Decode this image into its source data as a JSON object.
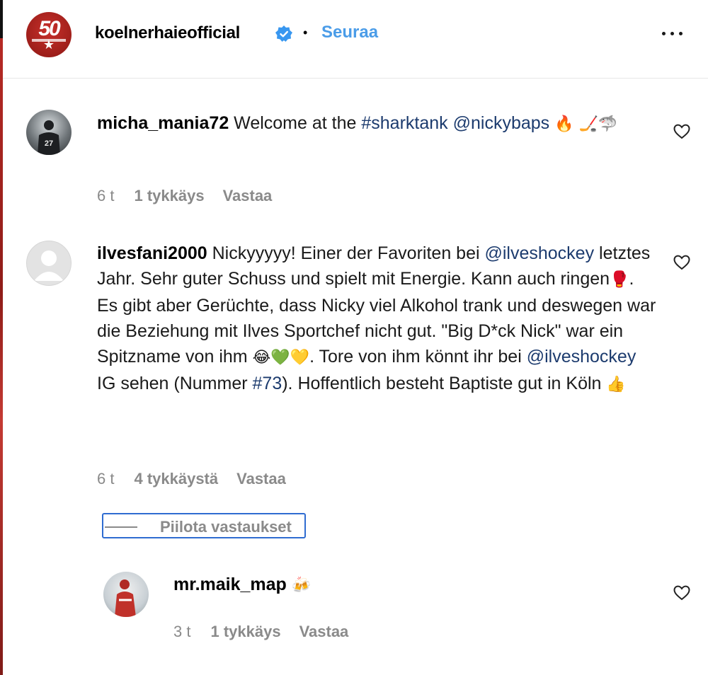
{
  "header": {
    "account": "koelnerhaieofficial",
    "logo_text": "50",
    "separator": "•",
    "follow_label": "Seuraa"
  },
  "comments": [
    {
      "username": "micha_mania72",
      "text_plain": "Welcome at the",
      "hashtag": "#sharktank",
      "mention": "@nickybaps",
      "emojis": "🔥 🏒🦈",
      "time": "6 t",
      "likes": "1 tykkäys",
      "reply": "Vastaa"
    },
    {
      "username": "ilvesfani2000",
      "t1": "Nickyyyyy! Einer der Favoriten bei",
      "mention1": "@ilveshockey",
      "t2": "letztes Jahr. Sehr guter Schuss und spielt mit Energie. Kann auch ringen",
      "e1": "🥊",
      "t3": ". Es gibt aber Gerüchte, dass Nicky viel Alkohol trank und deswegen war die Beziehung mit Ilves Sportchef nicht gut. \"Big D*ck Nick\" war ein Spitzname von ihm",
      "e2": "😂💚💛",
      "t4": ". Tore von ihm könnt ihr bei",
      "mention2": "@ilveshockey",
      "t5": "IG sehen (Nummer",
      "hashtag": "#73",
      "t6": "). Hoffentlich besteht Baptiste gut in Köln",
      "e3": "👍",
      "time": "6 t",
      "likes": "4 tykkäystä",
      "reply": "Vastaa"
    }
  ],
  "hide_replies_label": "Piilota vastaukset",
  "reply_comment": {
    "username": "mr.maik_map",
    "emoji": "🍻",
    "time": "3 t",
    "likes": "1 tykkäys",
    "reply": "Vastaa"
  },
  "colors": {
    "follow": "#4a9ce8",
    "link": "#1c3b6e",
    "meta": "#8a8a8a",
    "focus_outline": "#2f6cd1"
  }
}
